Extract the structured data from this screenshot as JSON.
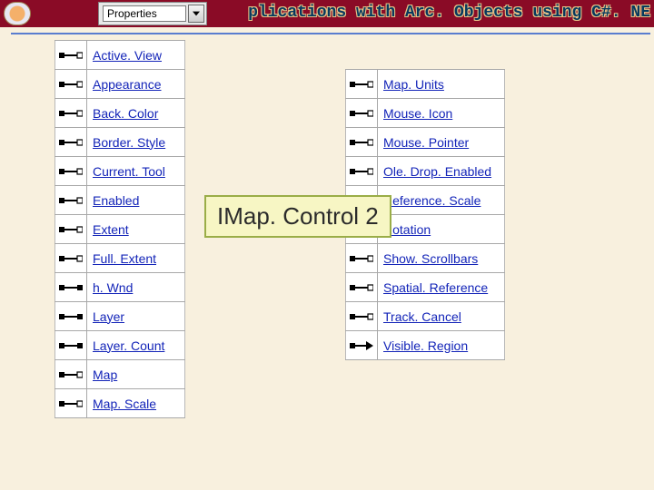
{
  "header": {
    "title_fragment": "plications with Arc. Objects using C#. NE"
  },
  "dropdown": {
    "label": "Properties"
  },
  "class_box": {
    "name": "IMap. Control 2"
  },
  "properties_left": [
    {
      "name": "Active. View",
      "access": "rw"
    },
    {
      "name": "Appearance",
      "access": "rw"
    },
    {
      "name": "Back. Color",
      "access": "rw"
    },
    {
      "name": "Border. Style",
      "access": "rw"
    },
    {
      "name": "Current. Tool",
      "access": "rw"
    },
    {
      "name": "Enabled",
      "access": "rw"
    },
    {
      "name": "Extent",
      "access": "rw"
    },
    {
      "name": "Full. Extent",
      "access": "rw"
    },
    {
      "name": "h. Wnd",
      "access": "ro"
    },
    {
      "name": "Layer",
      "access": "ro"
    },
    {
      "name": "Layer. Count",
      "access": "ro"
    },
    {
      "name": "Map",
      "access": "rw"
    },
    {
      "name": "Map. Scale",
      "access": "rw"
    }
  ],
  "properties_right": [
    {
      "name": "Map. Units",
      "access": "rw"
    },
    {
      "name": "Mouse. Icon",
      "access": "rw"
    },
    {
      "name": "Mouse. Pointer",
      "access": "rw"
    },
    {
      "name": "Ole. Drop. Enabled",
      "access": "rw"
    },
    {
      "name": "Reference. Scale",
      "access": "rw"
    },
    {
      "name": "Rotation",
      "access": "rw"
    },
    {
      "name": "Show. Scrollbars",
      "access": "rw"
    },
    {
      "name": "Spatial. Reference",
      "access": "rw"
    },
    {
      "name": "Track. Cancel",
      "access": "rw"
    },
    {
      "name": "Visible. Region",
      "access": "wo"
    }
  ]
}
